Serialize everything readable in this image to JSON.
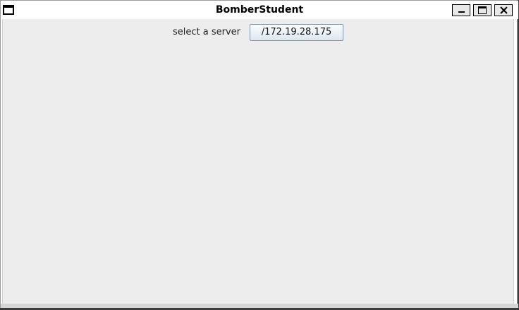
{
  "window": {
    "title": "BomberStudent",
    "icon": "window-icon",
    "controls": {
      "minimize_icon": "minimize-icon",
      "maximize_icon": "maximize-icon",
      "close_icon": "close-icon"
    }
  },
  "main": {
    "server_label": "select a server",
    "server_button_label": "/172.19.28.175"
  }
}
